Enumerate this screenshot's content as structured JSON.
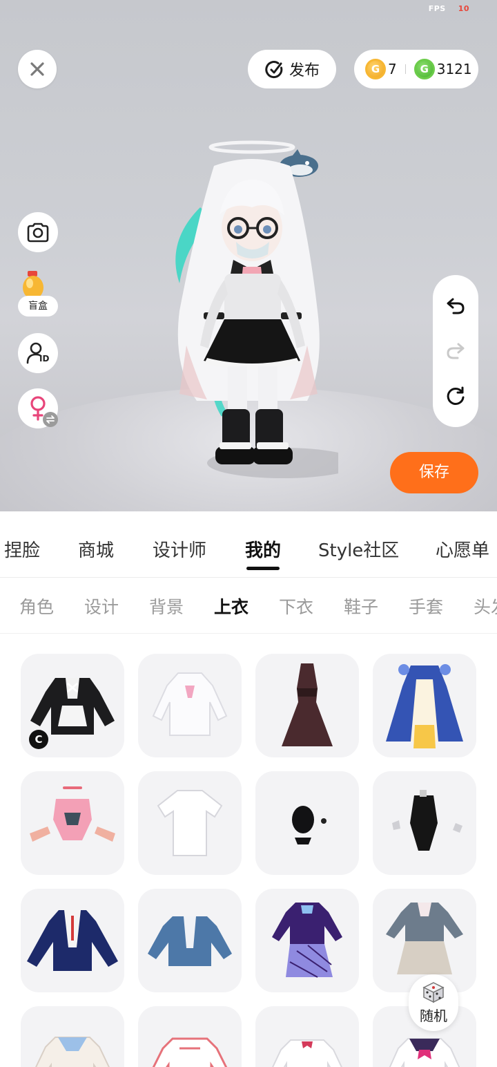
{
  "fps": {
    "label": "FPS",
    "value": "10"
  },
  "top": {
    "close_icon": "close-icon",
    "publish_label": "发布",
    "gold_coin": "7",
    "green_coin": "3121",
    "gold_symbol": "G",
    "green_symbol": "G"
  },
  "tools": {
    "blindbox_label": "盲盒",
    "id_badge": "ID"
  },
  "save_label": "保存",
  "main_tabs": [
    "捏脸",
    "商城",
    "设计师",
    "我的",
    "Style社区",
    "心愿单"
  ],
  "main_tab_active": "我的",
  "sub_tabs": [
    "角色",
    "设计",
    "背景",
    "上衣",
    "下衣",
    "鞋子",
    "手套",
    "头发"
  ],
  "sub_tab_active": "上衣",
  "items": [
    {
      "name": "black maid hoodie",
      "badge": "C"
    },
    {
      "name": "white hoodie dress"
    },
    {
      "name": "brown halter dress"
    },
    {
      "name": "blue gold gown"
    },
    {
      "name": "pink crop set"
    },
    {
      "name": "white t-shirt"
    },
    {
      "name": "black small top"
    },
    {
      "name": "black bodysuit"
    },
    {
      "name": "navy blazer"
    },
    {
      "name": "denim jacket"
    },
    {
      "name": "purple plaid dress"
    },
    {
      "name": "grey school uniform"
    },
    {
      "name": "sailor shirt"
    },
    {
      "name": "pink shirt"
    },
    {
      "name": "white shirt bow"
    },
    {
      "name": "sailor uniform"
    }
  ],
  "random_label": "随机",
  "colors": {
    "accent": "#ff6f1a",
    "gold": "#f7b733",
    "green": "#6ccc4a"
  }
}
